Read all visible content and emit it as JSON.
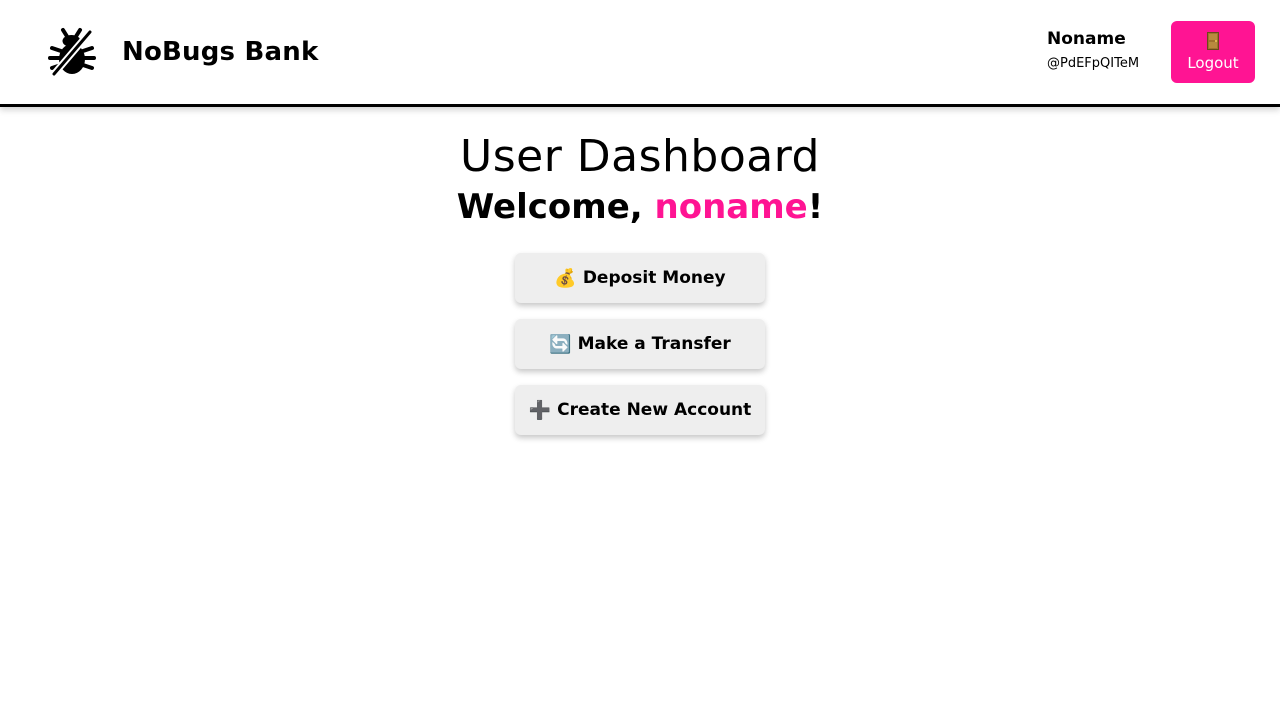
{
  "header": {
    "brand_name": "NoBugs Bank",
    "logo_icon": "bug-crossed-icon",
    "user": {
      "display_name": "Noname",
      "handle": "@PdEFpQITeM"
    },
    "logout": {
      "label": "Logout",
      "icon": "door-icon"
    }
  },
  "main": {
    "title": "User Dashboard",
    "welcome_prefix": "Welcome, ",
    "welcome_name": "noname",
    "welcome_suffix": "!",
    "actions": [
      {
        "icon": "💰",
        "icon_name": "money-bag-icon",
        "label": "Deposit Money"
      },
      {
        "icon": "🔄",
        "icon_name": "refresh-arrows-icon",
        "label": "Make a Transfer"
      },
      {
        "icon": "➕",
        "icon_name": "plus-icon",
        "label": "Create New Account"
      }
    ]
  },
  "colors": {
    "accent": "#ff1493",
    "button_bg": "#eeeeee",
    "text": "#000000"
  }
}
